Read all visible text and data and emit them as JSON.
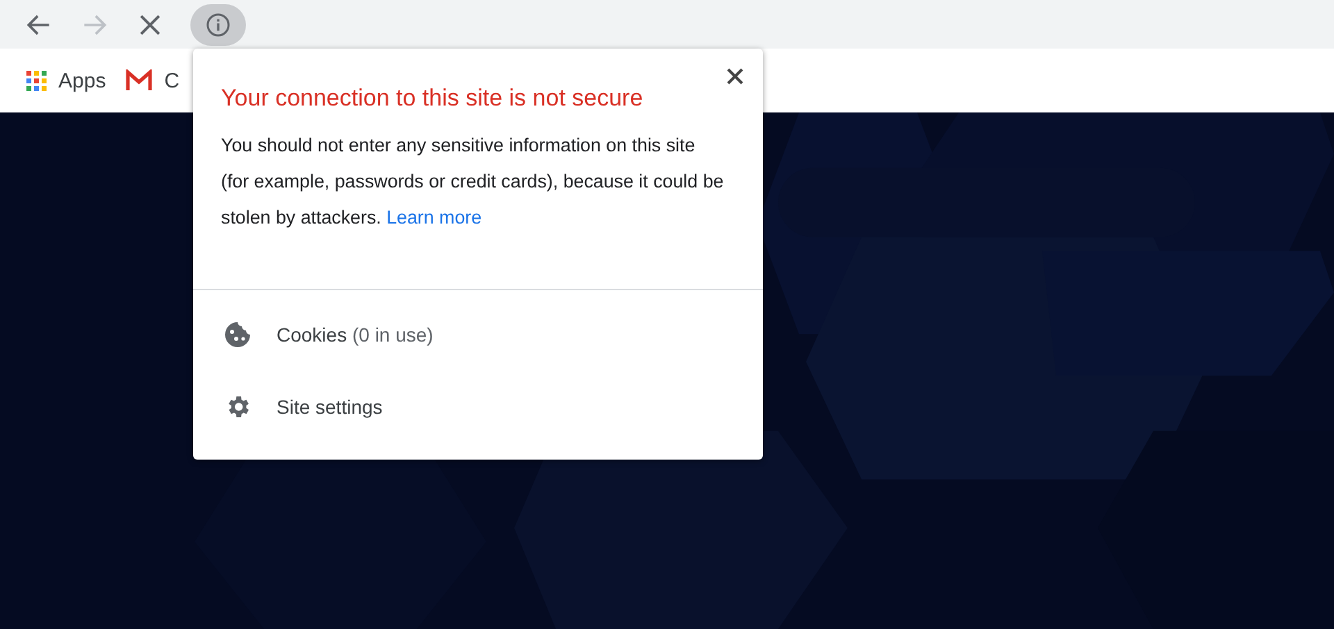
{
  "toolbar": {
    "nav_buttons": [
      {
        "kind": "back",
        "disabled": false
      },
      {
        "kind": "forward",
        "disabled": true
      },
      {
        "kind": "stop",
        "disabled": false
      }
    ],
    "site_info": {
      "selected": true
    }
  },
  "bookmarks": [
    {
      "kind": "apps",
      "label": "Apps"
    },
    {
      "kind": "gmail",
      "label": "C"
    }
  ],
  "popup": {
    "title": "Your connection to this site is not secure",
    "body": "You should not enter any sensitive information on this site (for example, passwords or credit cards), because it could be stolen by attackers.",
    "link": "Learn more",
    "items": [
      {
        "kind": "cookies",
        "label": "Cookies",
        "detail": "(0 in use)"
      },
      {
        "kind": "settings",
        "label": "Site settings"
      }
    ]
  }
}
